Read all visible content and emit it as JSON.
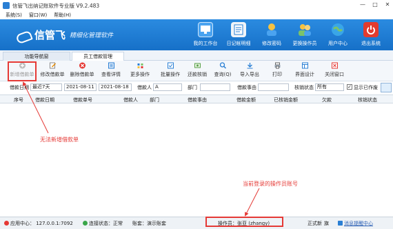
{
  "window": {
    "title": "信管飞出纳记账软件专业版 V9.2.483",
    "controls": [
      "—",
      "□",
      "✕"
    ]
  },
  "menu": [
    "系统(S)",
    "窗口(W)",
    "帮助(H)"
  ],
  "banner": {
    "brand": "信管飞",
    "slogan": "精细化管理软件",
    "nav": [
      {
        "label": "我的工作台",
        "icon": "desktop-icon",
        "color": "#4aa3f0"
      },
      {
        "label": "日记帐明细",
        "icon": "ledger-icon",
        "color": "#f0f4f8"
      },
      {
        "label": "修改密码",
        "icon": "user-key-icon",
        "color": "#f5c242"
      },
      {
        "label": "更换操作员",
        "icon": "users-icon",
        "color": "#7bc36a"
      },
      {
        "label": "用户中心",
        "icon": "globe-icon",
        "color": "#39a6e8"
      },
      {
        "label": "退出系统",
        "icon": "power-icon",
        "color": "#e23b2e"
      }
    ]
  },
  "tabs": [
    {
      "label": "功能导航窗"
    },
    {
      "label": "员工借款管理"
    }
  ],
  "toolbar": [
    {
      "label": "新增借款单",
      "icon": "add-icon",
      "enabled": false
    },
    {
      "label": "修改借款单",
      "icon": "edit-icon",
      "enabled": true
    },
    {
      "label": "删除借款单",
      "icon": "delete-icon",
      "enabled": true
    },
    {
      "label": "查看详情",
      "icon": "view-icon",
      "enabled": true
    },
    {
      "label": "更多操作",
      "icon": "more-icon",
      "enabled": true
    },
    {
      "label": "批量操作",
      "icon": "batch-icon",
      "enabled": true
    },
    {
      "label": "还款核销",
      "icon": "repay-icon",
      "enabled": true
    },
    {
      "label": "查询(Q)",
      "icon": "query-icon",
      "enabled": true
    },
    {
      "label": "导入导出",
      "icon": "import-export-icon",
      "enabled": true
    },
    {
      "label": "打印",
      "icon": "print-icon",
      "enabled": true
    },
    {
      "label": "界面设计",
      "icon": "design-icon",
      "enabled": true
    },
    {
      "label": "关闭窗口",
      "icon": "close-window-icon",
      "enabled": true
    }
  ],
  "filter": {
    "date_label": "借款日期",
    "period": "最近7天",
    "start": "2021-08-11",
    "end": "2021-08-18",
    "borrower_label": "借款人",
    "borrower_marker": "A",
    "dept_label": "部门",
    "reason_label": "借款事由",
    "status_label": "核销状态",
    "status_value": "所有",
    "show_void_label": "显示已作废"
  },
  "grid": {
    "columns": [
      "序号",
      "借款日期",
      "借款单号",
      "借款人",
      "部门",
      "借款事由",
      "借款金额",
      "已核销金额",
      "欠款",
      "核销状态"
    ]
  },
  "annotations": {
    "no_new": "无法新增借款单",
    "operator_note": "当前登录的操作员账号"
  },
  "status": {
    "app_center": "应用中心： 127.0.0.1:7092",
    "connection": "连接状态：正常",
    "account_set": "账套：演示账套",
    "operator": "操作员：张亚 (zhangy)",
    "edition": "正式新",
    "edition_suffix": "旗",
    "message": "消息提醒中心"
  }
}
